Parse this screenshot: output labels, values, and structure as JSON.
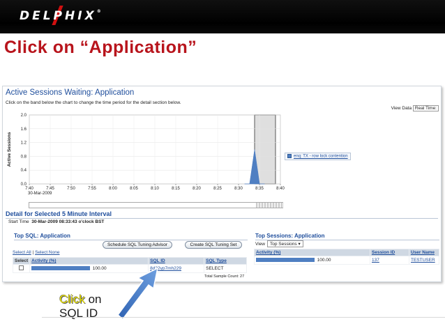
{
  "header": {
    "logo_text": "DELPHIX",
    "reg_mark": "®"
  },
  "slide": {
    "title": "Click on “Application”"
  },
  "panel": {
    "title": "Active Sessions Waiting: Application",
    "hint": "Click on the band below the chart to change the time period for the detail section below.",
    "view_data_label": "View Data",
    "view_data_value": "Real Time:"
  },
  "chart_data": {
    "type": "area",
    "ylabel": "Active Sessions",
    "yticks": [
      "2.0",
      "1.6",
      "1.2",
      "0.8",
      "0.4",
      "0.0"
    ],
    "ylim": [
      0,
      2.0
    ],
    "xticks": [
      "7:40",
      "7:45",
      "7:50",
      "7:55",
      "8:00",
      "8:05",
      "8:10",
      "8:15",
      "8:20",
      "8:25",
      "8:30",
      "8:35",
      "8:40"
    ],
    "x_date_label": "30-Mar-2009",
    "series": [
      {
        "name": "enq: TX - row lock contention",
        "color": "#4f7fc2",
        "x": [
          "8:33",
          "8:34",
          "8:35",
          "8:36",
          "8:37"
        ],
        "values": [
          0.0,
          0.0,
          1.0,
          0.0,
          0.0
        ]
      }
    ],
    "selected_window": [
      "8:35",
      "8:40"
    ],
    "grid": true,
    "legend_position": "right"
  },
  "detail": {
    "title": "Detail for Selected 5 Minute Interval",
    "start_label": "Start Time",
    "start_value": "30-Mar-2009 08:33:43 o'clock BST"
  },
  "top_sql": {
    "title": "Top SQL: Application",
    "schedule_button": "Schedule SQL Tuning Advisor",
    "create_button": "Create SQL Tuning Set",
    "select_all": "Select All",
    "select_none": "Select None",
    "columns": [
      "Select",
      "Activity (%)",
      "SQL ID",
      "SQL Type"
    ],
    "rows": [
      {
        "activity": "100.00",
        "activity_fraction": 1.0,
        "sql_id": "8d22yp7mh229",
        "sql_type": "SELECT"
      }
    ],
    "total": "Total Sample Count: 27"
  },
  "top_sessions": {
    "title": "Top Sessions: Application",
    "view_label": "View",
    "view_value": "Top Sessions",
    "columns": [
      "Activity (%)",
      "Session ID",
      "User Name"
    ],
    "rows": [
      {
        "activity": "100.00",
        "activity_fraction": 1.0,
        "session_id": "137",
        "user_name": "TESTUSER"
      }
    ]
  },
  "callout": {
    "highlight": "Click",
    "rest": " on",
    "line2": "SQL ID"
  }
}
